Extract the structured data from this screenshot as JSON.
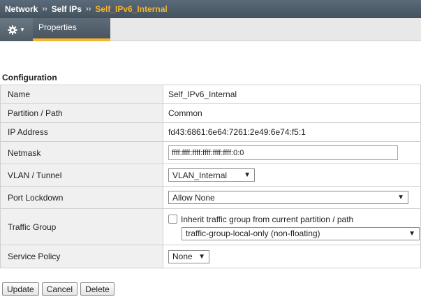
{
  "breadcrumb": {
    "items": [
      "Network",
      "Self IPs"
    ],
    "separator": "››",
    "current": "Self_IPv6_Internal"
  },
  "tabs": {
    "gear_menu": "gear-icon",
    "active_tab": "Properties"
  },
  "section": {
    "title": "Configuration"
  },
  "fields": {
    "name": {
      "label": "Name",
      "value": "Self_IPv6_Internal"
    },
    "partition": {
      "label": "Partition / Path",
      "value": "Common"
    },
    "ip_address": {
      "label": "IP Address",
      "value": "fd43:6861:6e64:7261:2e49:6e74:f5:1"
    },
    "netmask": {
      "label": "Netmask",
      "value": "ffff:ffff:ffff:ffff:ffff:ffff:0:0"
    },
    "vlan": {
      "label": "VLAN / Tunnel",
      "value": "VLAN_Internal"
    },
    "port_lockdown": {
      "label": "Port Lockdown",
      "value": "Allow None"
    },
    "traffic_group": {
      "label": "Traffic Group",
      "inherit_label": "Inherit traffic group from current partition / path",
      "inherit_checked": false,
      "value": "traffic-group-local-only (non-floating)"
    },
    "service_policy": {
      "label": "Service Policy",
      "value": "None"
    }
  },
  "actions": {
    "update": "Update",
    "cancel": "Cancel",
    "delete": "Delete"
  },
  "colors": {
    "accent": "#f7b52e",
    "header": "#4f5c67",
    "label_bg": "#f0f0f0"
  }
}
